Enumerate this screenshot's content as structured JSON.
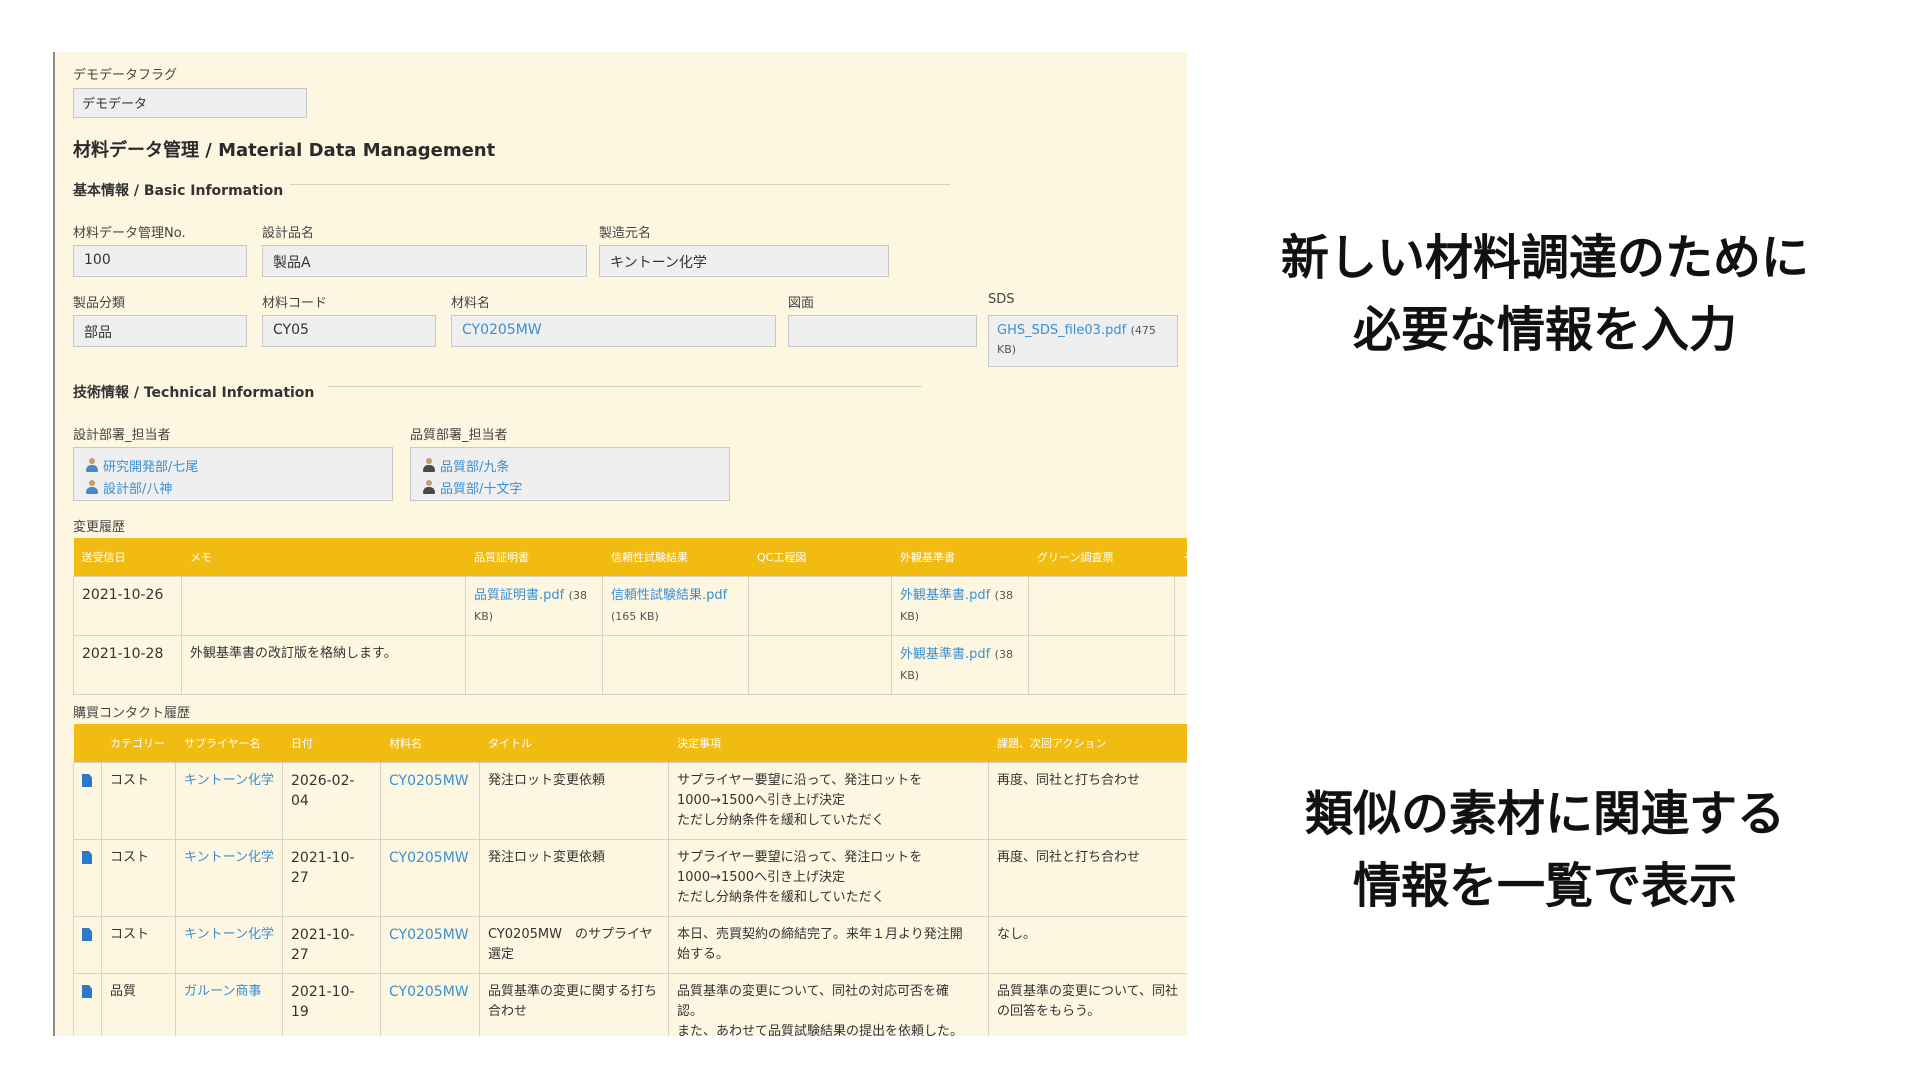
{
  "demo": {
    "label": "デモデータフラグ",
    "value": "デモデータ"
  },
  "page_title": "材料データ管理 / Material Data Management",
  "basic": {
    "title": "基本情報 / Basic Information",
    "no_label": "材料データ管理No.",
    "no_value": "100",
    "design_label": "設計品名",
    "design_value": "製品A",
    "maker_label": "製造元名",
    "maker_value": "キントーン化学",
    "category_label": "製品分類",
    "category_value": "部品",
    "code_label": "材料コード",
    "code_value": "CY05",
    "name_label": "材料名",
    "name_value": "CY0205MW",
    "drawing_label": "図面",
    "drawing_value": "",
    "sds_label": "SDS",
    "sds_file": "GHS_SDS_file03.pdf",
    "sds_size_a": "(475",
    "sds_size_b": "KB)"
  },
  "tech": {
    "title": "技術情報 / Technical Information",
    "design_staff_label": "設計部署_担当者",
    "design_staff": [
      "研究開発部/七尾",
      "設計部/八神"
    ],
    "quality_staff_label": "品質部署_担当者",
    "quality_staff": [
      "品質部/九条",
      "品質部/十文字"
    ]
  },
  "history": {
    "title": "変更履歴",
    "headers": [
      "送受信日",
      "メモ",
      "品質証明書",
      "信頼性試験結果",
      "QC工程図",
      "外観基準書",
      "グリーン調査票",
      "そ"
    ],
    "rows": [
      {
        "date": "2021-10-26",
        "memo": "",
        "cert_file": "品質証明書.pdf",
        "cert_size_a": "(38",
        "cert_size_b": "KB)",
        "rel_file": "信頼性試験結果.pdf",
        "rel_size": "(165 KB)",
        "qc": "",
        "app_file": "外観基準書.pdf",
        "app_size_a": "(38",
        "app_size_b": "KB)",
        "green": ""
      },
      {
        "date": "2021-10-28",
        "memo": "外観基準書の改訂版を格納します。",
        "cert_file": "",
        "cert_size_a": "",
        "cert_size_b": "",
        "rel_file": "",
        "rel_size": "",
        "qc": "",
        "app_file": "外観基準書.pdf",
        "app_size_a": "(38",
        "app_size_b": "KB)",
        "green": ""
      }
    ]
  },
  "contacts": {
    "title": "購買コンタクト履歴",
    "headers": [
      "",
      "カテゴリー",
      "サプライヤー名",
      "日付",
      "材料名",
      "タイトル",
      "決定事項",
      "課題、次回アクション"
    ],
    "rows": [
      {
        "category": "コスト",
        "supplier": "キントーン化学",
        "date": "2026-02-04",
        "material": "CY0205MW",
        "title": "発注ロット変更依頼",
        "decision": [
          "サプライヤー要望に沿って、発注ロットを",
          "1000→1500へ引き上げ決定",
          "ただし分納条件を緩和していただく"
        ],
        "action": "再度、同社と打ち合わせ"
      },
      {
        "category": "コスト",
        "supplier": "キントーン化学",
        "date": "2021-10-27",
        "material": "CY0205MW",
        "title": "発注ロット変更依頼",
        "decision": [
          "サプライヤー要望に沿って、発注ロットを",
          "1000→1500へ引き上げ決定",
          "ただし分納条件を緩和していただく"
        ],
        "action": "再度、同社と打ち合わせ"
      },
      {
        "category": "コスト",
        "supplier": "キントーン化学",
        "date": "2021-10-27",
        "material": "CY0205MW",
        "title": "CY0205MW　のサプライヤ選定",
        "decision": [
          "本日、売買契約の締結完了。来年１月より発注開",
          "始する。"
        ],
        "action": "なし。"
      },
      {
        "category": "品質",
        "supplier": "ガルーン商事",
        "date": "2021-10-19",
        "material": "CY0205MW",
        "title": "品質基準の変更に関する打ち合わせ",
        "decision": [
          "品質基準の変更について、同社の対応可否を確",
          "認。",
          "また、あわせて品質試験結果の提出を依頼した。"
        ],
        "action": "品質基準の変更について、同社の回答をもらう。"
      }
    ]
  },
  "captions": {
    "top": [
      "新しい材料調達のために",
      "必要な情報を入力"
    ],
    "bottom": [
      "類似の素材に関連する",
      "情報を一覧で表示"
    ]
  },
  "colors": {
    "panel_bg": "#fdf7e2",
    "header_yellow": "#f2bb12",
    "link": "#3a8fd2"
  }
}
